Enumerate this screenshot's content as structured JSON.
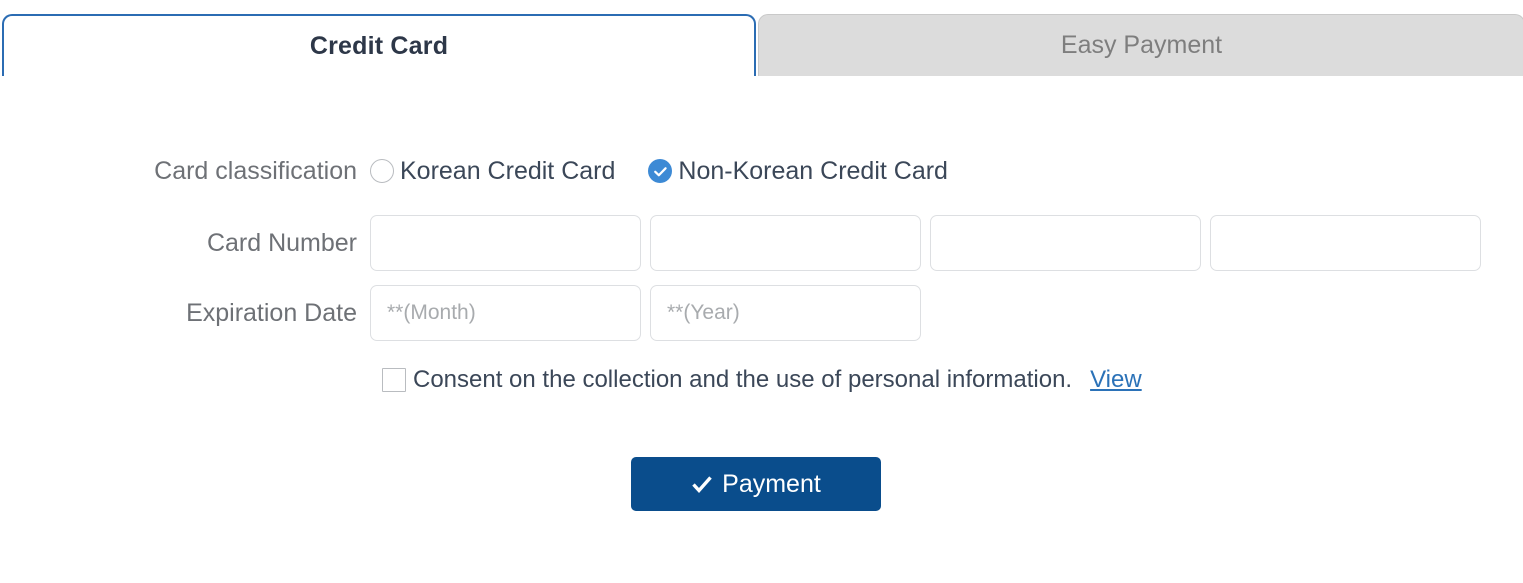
{
  "tabs": [
    {
      "label": "Credit Card",
      "active": true
    },
    {
      "label": "Easy Payment",
      "active": false
    }
  ],
  "form": {
    "classification": {
      "label": "Card classification",
      "options": [
        {
          "label": "Korean Credit Card",
          "selected": false
        },
        {
          "label": "Non-Korean Credit Card",
          "selected": true
        }
      ]
    },
    "card_number": {
      "label": "Card Number",
      "values": [
        "",
        "",
        "",
        ""
      ],
      "placeholders": [
        "",
        "",
        "",
        ""
      ]
    },
    "expiration": {
      "label": "Expiration Date",
      "month_value": "",
      "month_placeholder": "**(Month)",
      "year_value": "",
      "year_placeholder": "**(Year)"
    },
    "consent": {
      "text": "Consent on the collection and the use of personal information.",
      "link_label": "View",
      "checked": false
    },
    "submit": {
      "label": "Payment",
      "icon": "check-icon"
    }
  },
  "colors": {
    "active_tab_border": "#2b6cb3",
    "inactive_tab_bg": "#dcdcdc",
    "radio_selected": "#3d8ad5",
    "link": "#2b72b8",
    "submit_bg": "#0a4d8c",
    "label_text": "#6e7176",
    "body_text": "#3b4758"
  }
}
